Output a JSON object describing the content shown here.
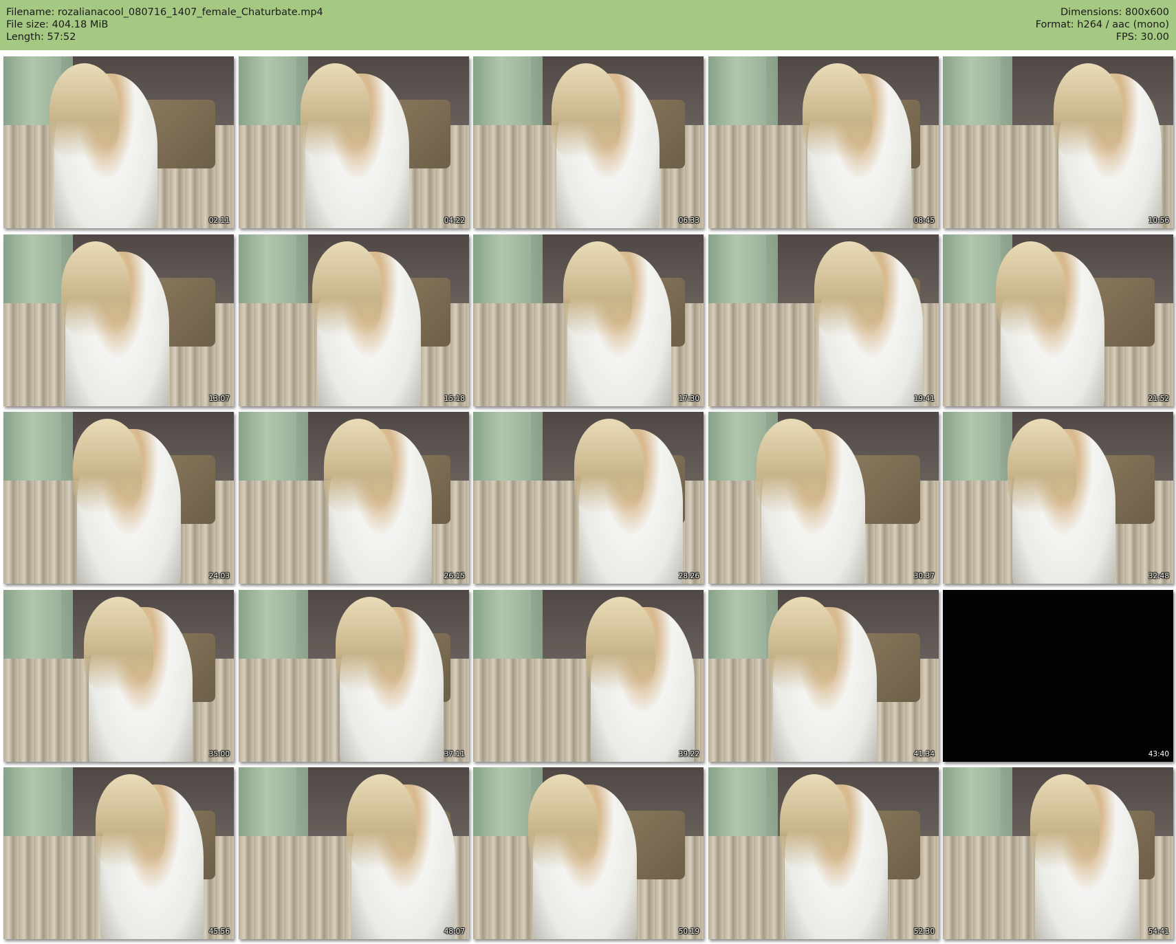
{
  "header": {
    "filename": "Filename: rozalianacool_080716_1407_female_Chaturbate.mp4",
    "filesize": "File size: 404.18 MiB",
    "length": "Length: 57:52",
    "dimensions": "Dimensions: 800x600",
    "format": "Format: h264 / aac (mono)",
    "fps": "FPS: 30.00"
  },
  "thumbnails": [
    {
      "time": "02:11"
    },
    {
      "time": "04:22"
    },
    {
      "time": "06:33"
    },
    {
      "time": "08:45"
    },
    {
      "time": "10:56"
    },
    {
      "time": "13:07"
    },
    {
      "time": "15:18"
    },
    {
      "time": "17:30"
    },
    {
      "time": "19:41"
    },
    {
      "time": "21:52"
    },
    {
      "time": "24:03"
    },
    {
      "time": "26:15"
    },
    {
      "time": "28:26"
    },
    {
      "time": "30:37"
    },
    {
      "time": "32:48"
    },
    {
      "time": "35:00"
    },
    {
      "time": "37:11"
    },
    {
      "time": "39:22"
    },
    {
      "time": "41:34"
    },
    {
      "time": "43:40"
    },
    {
      "time": "45:56"
    },
    {
      "time": "48:07"
    },
    {
      "time": "50:19"
    },
    {
      "time": "52:30"
    },
    {
      "time": "54:41"
    }
  ],
  "colors": {
    "header_bg": "#a5c882",
    "page_bg": "#ffffff",
    "timestamp_text": "#ffffff"
  }
}
